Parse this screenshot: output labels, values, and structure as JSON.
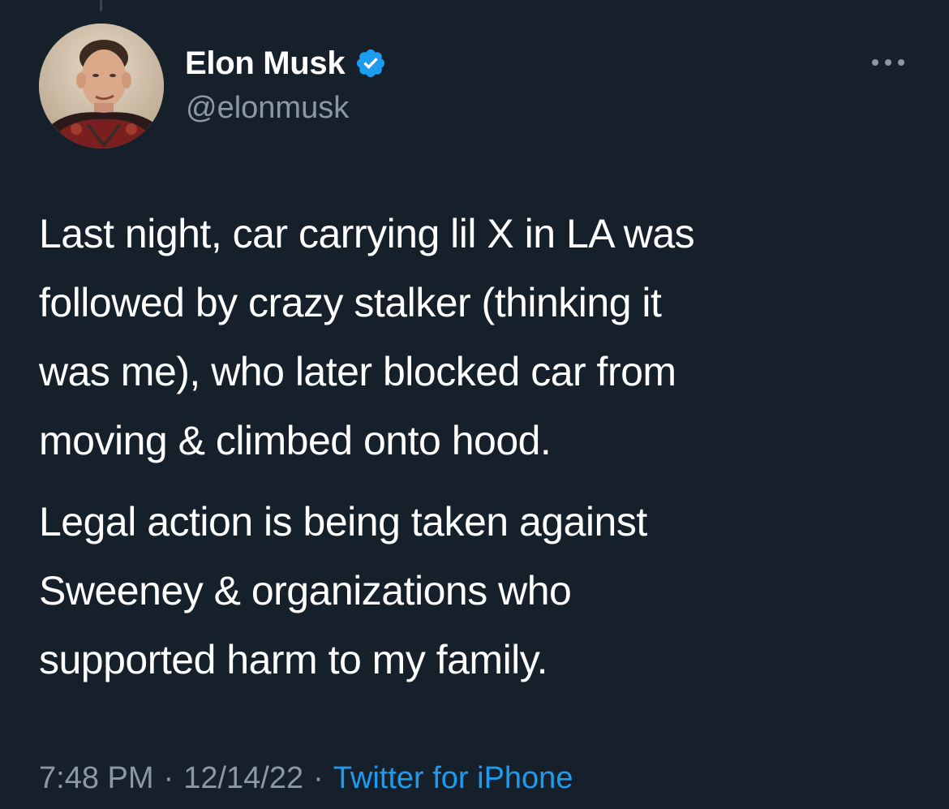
{
  "colors": {
    "background": "#15202b",
    "text_primary": "#ffffff",
    "text_secondary": "#8b98a5",
    "accent": "#1d9bf0"
  },
  "author": {
    "display_name": "Elon Musk",
    "handle": "@elonmusk",
    "verified_icon": "verified-badge-icon",
    "avatar_icon": "avatar-photo"
  },
  "more_icon": "more-options-icon",
  "tweet": {
    "paragraphs": [
      "Last night, car carrying lil X in LA was\nfollowed by crazy stalker (thinking it\nwas me), who later blocked car from\nmoving & climbed onto hood.",
      "Legal action is being taken against\nSweeney & organizations who\nsupported harm to my family."
    ]
  },
  "meta": {
    "time": "7:48 PM",
    "date": "12/14/22",
    "separator": "·",
    "source": "Twitter for iPhone"
  }
}
